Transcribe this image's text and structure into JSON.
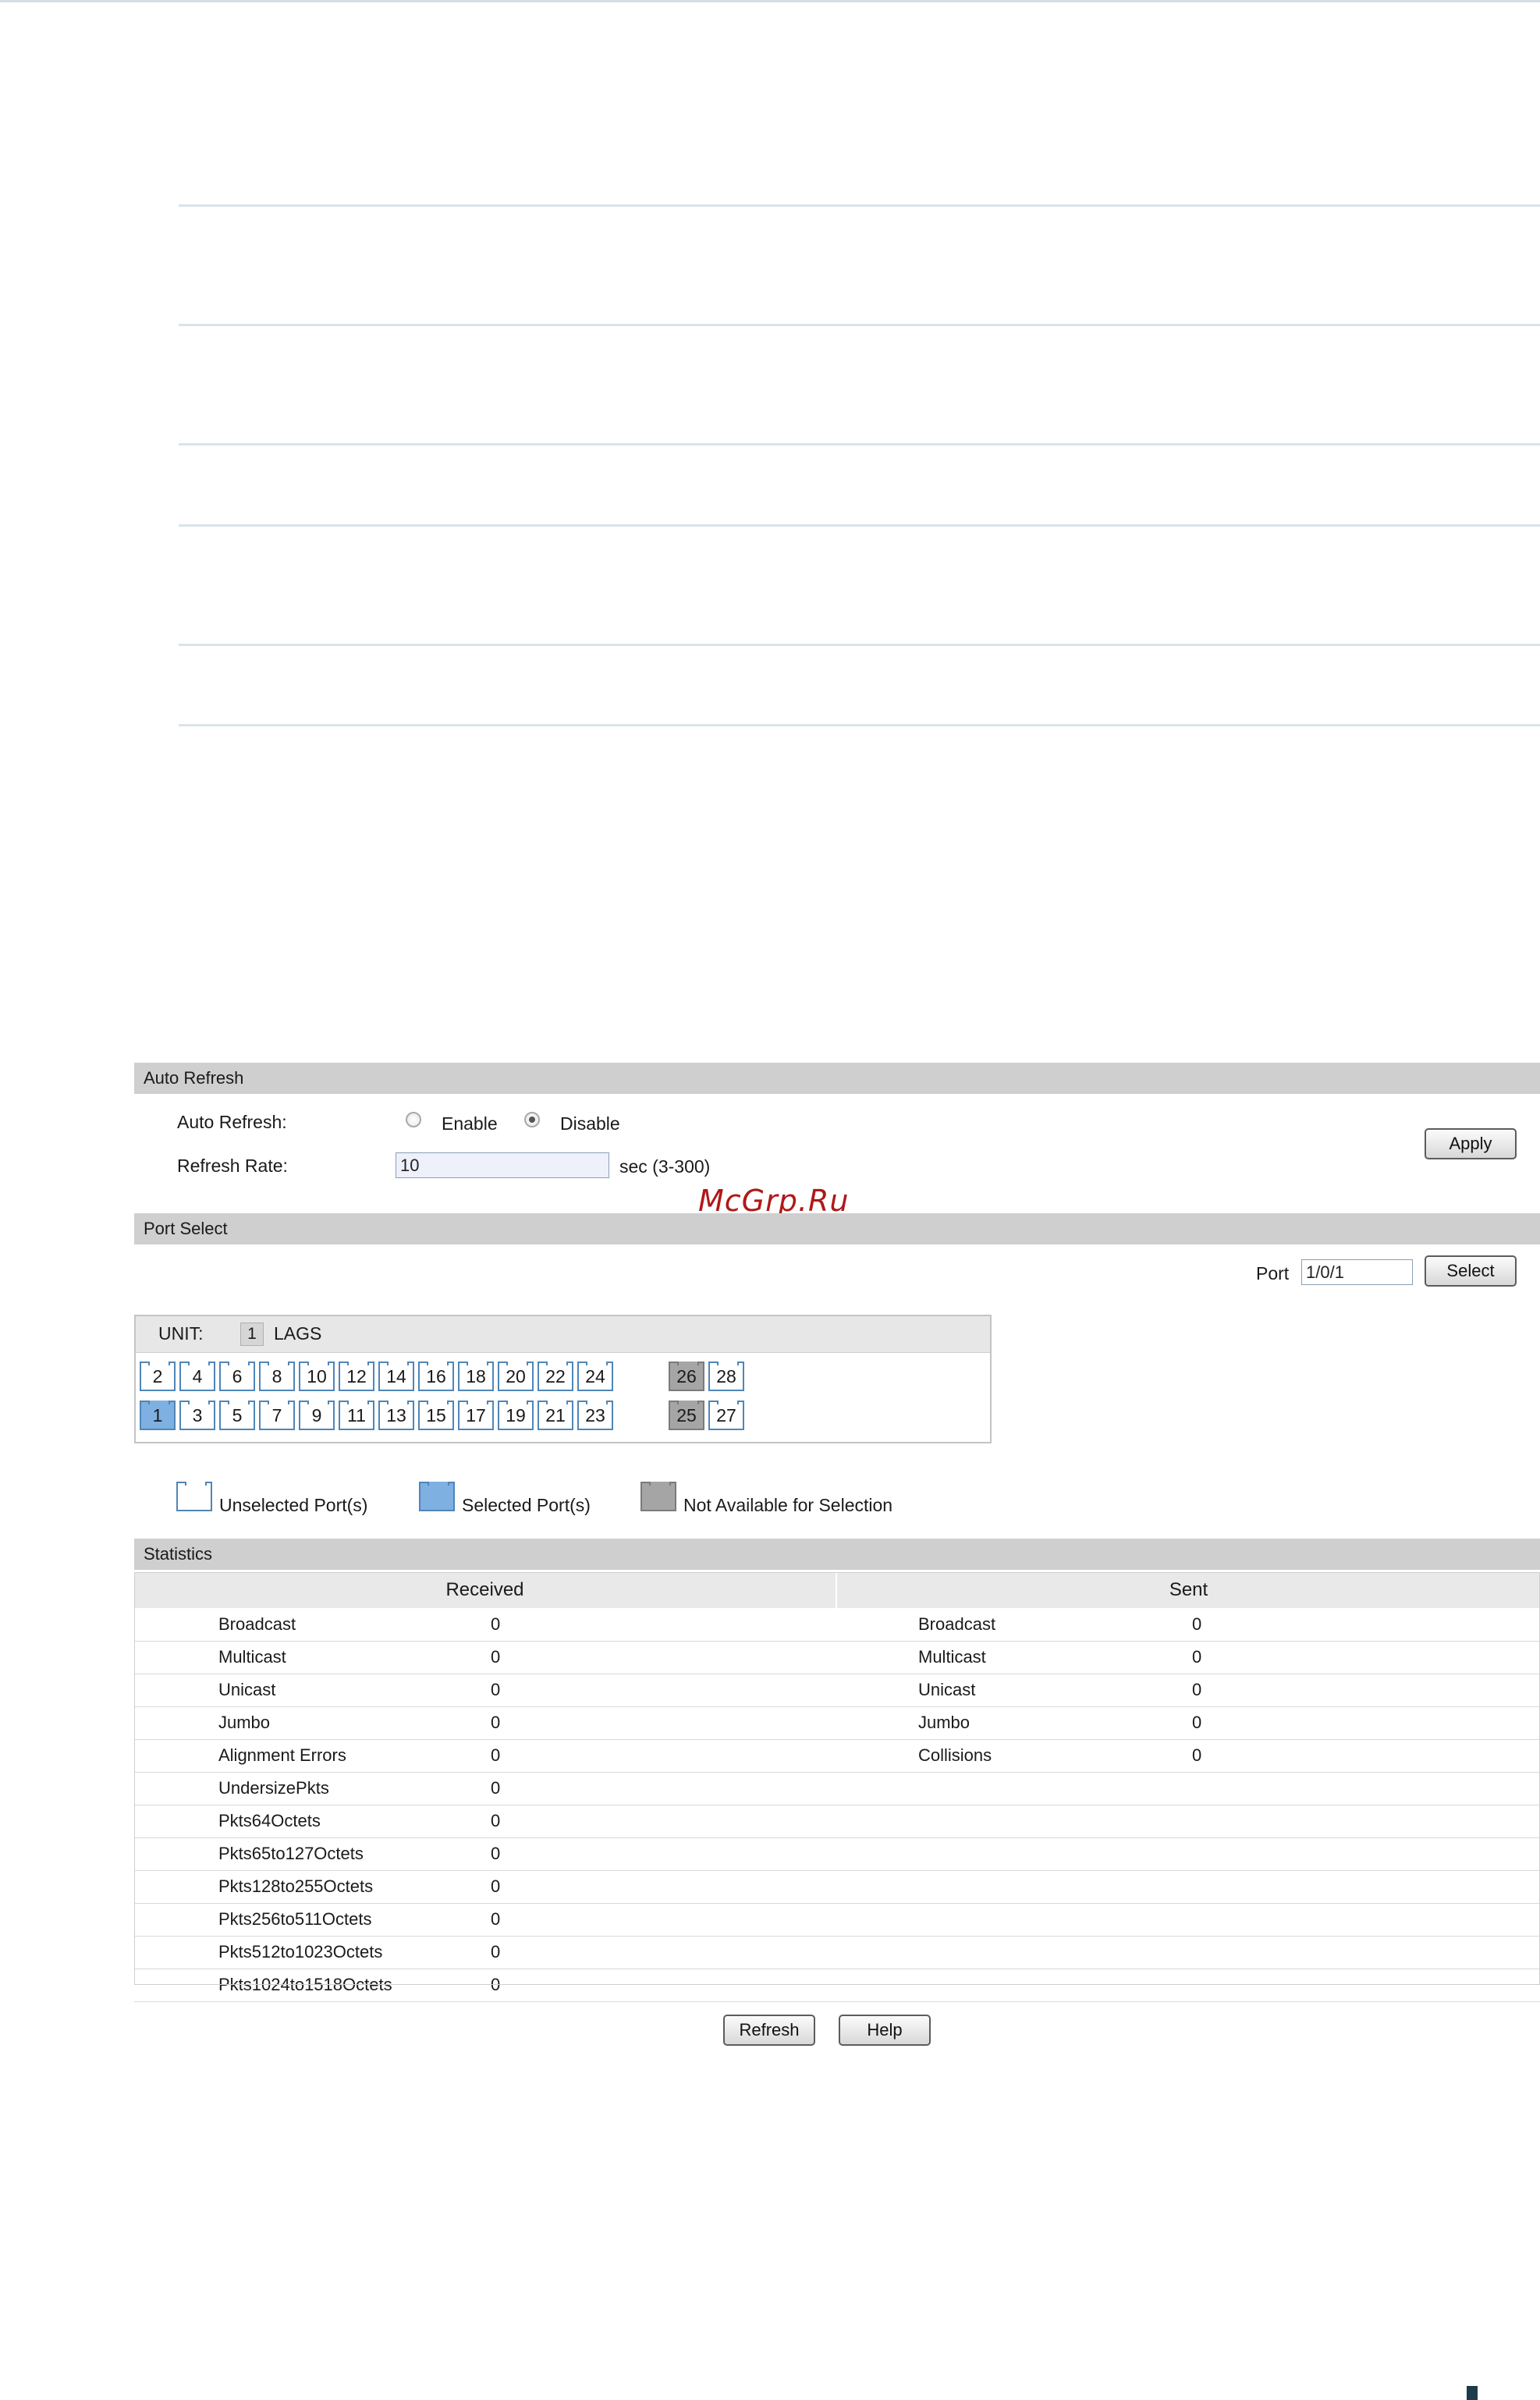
{
  "auto_refresh": {
    "section_title": "Auto Refresh",
    "auto_refresh_label": "Auto Refresh:",
    "enable_label": "Enable",
    "disable_label": "Disable",
    "selected": "Disable",
    "refresh_rate_label": "Refresh Rate:",
    "refresh_rate_value": "10",
    "refresh_rate_hint": "sec (3-300)",
    "apply_label": "Apply"
  },
  "watermark": "McGrp.Ru",
  "port_select": {
    "section_title": "Port Select",
    "port_label": "Port",
    "port_value": "1/0/1",
    "select_label": "Select",
    "unit_label": "UNIT:",
    "unit_value": "1",
    "lags_label": "LAGS",
    "top_row_ports": [
      "2",
      "4",
      "6",
      "8",
      "10",
      "12",
      "14",
      "16",
      "18",
      "20",
      "22",
      "24"
    ],
    "bottom_row_ports": [
      "1",
      "3",
      "5",
      "7",
      "9",
      "11",
      "13",
      "15",
      "17",
      "19",
      "21",
      "23"
    ],
    "top_extra_ports": [
      "26",
      "28"
    ],
    "bottom_extra_ports": [
      "25",
      "27"
    ],
    "selected_ports": [
      "1"
    ],
    "unavailable_ports": [
      "26",
      "25"
    ],
    "legend": {
      "unselected": "Unselected Port(s)",
      "selected": "Selected Port(s)",
      "not_available": "Not Available for Selection"
    }
  },
  "statistics": {
    "section_title": "Statistics",
    "received_header": "Received",
    "sent_header": "Sent",
    "received": [
      {
        "name": "Broadcast",
        "value": "0"
      },
      {
        "name": "Multicast",
        "value": "0"
      },
      {
        "name": "Unicast",
        "value": "0"
      },
      {
        "name": "Jumbo",
        "value": "0"
      },
      {
        "name": "Alignment Errors",
        "value": "0"
      },
      {
        "name": "UndersizePkts",
        "value": "0"
      },
      {
        "name": "Pkts64Octets",
        "value": "0"
      },
      {
        "name": "Pkts65to127Octets",
        "value": "0"
      },
      {
        "name": "Pkts128to255Octets",
        "value": "0"
      },
      {
        "name": "Pkts256to511Octets",
        "value": "0"
      },
      {
        "name": "Pkts512to1023Octets",
        "value": "0"
      },
      {
        "name": "Pkts1024to1518Octets",
        "value": "0"
      }
    ],
    "sent": [
      {
        "name": "Broadcast",
        "value": "0"
      },
      {
        "name": "Multicast",
        "value": "0"
      },
      {
        "name": "Unicast",
        "value": "0"
      },
      {
        "name": "Jumbo",
        "value": "0"
      },
      {
        "name": "Collisions",
        "value": "0"
      }
    ]
  },
  "footer": {
    "refresh_label": "Refresh",
    "help_label": "Help"
  }
}
